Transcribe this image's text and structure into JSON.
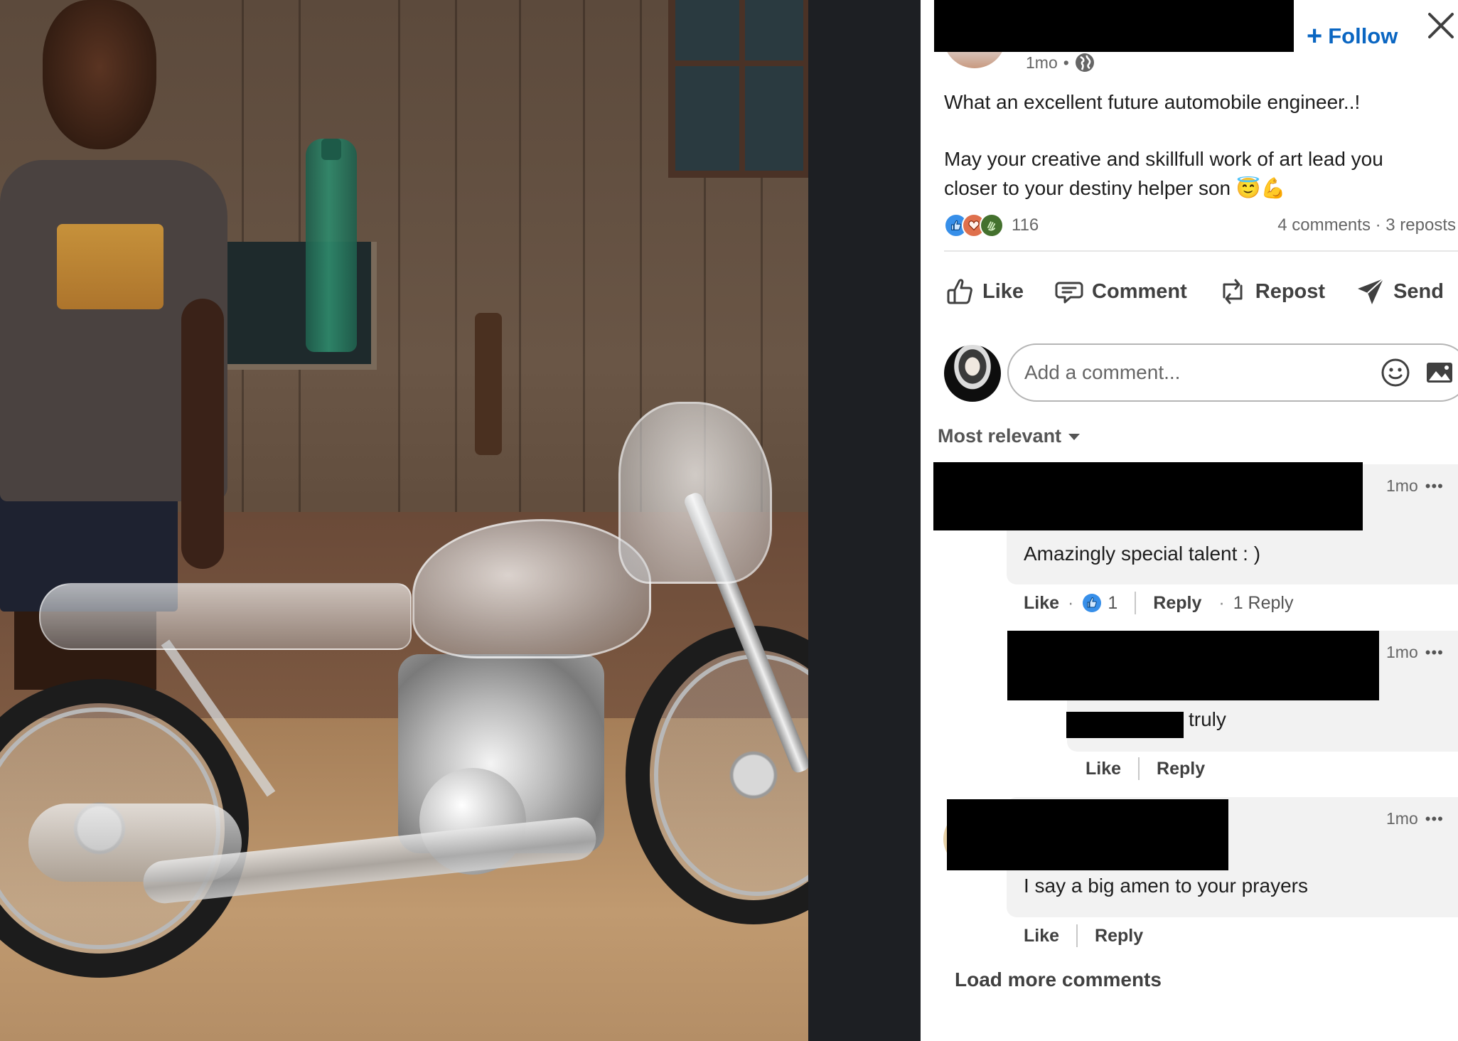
{
  "media": {
    "description": "Photo of a smiling boy standing beside a motorcycle built from transparent plastic bottles"
  },
  "post": {
    "author_name": "[redacted]",
    "follow_label": "Follow",
    "follow_icon": "plus-icon",
    "time": "1mo",
    "visibility_icon": "globe-icon",
    "text_lines": [
      "What an excellent future automobile engineer..!",
      "May your creative and skillfull work of art lead you",
      "closer to your destiny helper son 😇💪"
    ],
    "reactions": {
      "icons": [
        "like-icon",
        "love-icon",
        "celebrate-icon"
      ],
      "count": "116"
    },
    "comments_count": "4 comments",
    "reposts_count": "3 reposts",
    "comments_reposts": "4 comments · 3 reposts"
  },
  "actions": [
    {
      "label": "Like",
      "icon": "thumbs-up-icon"
    },
    {
      "label": "Comment",
      "icon": "comment-icon"
    },
    {
      "label": "Repost",
      "icon": "repost-icon"
    },
    {
      "label": "Send",
      "icon": "send-icon"
    }
  ],
  "comment_box": {
    "placeholder": "Add a comment...",
    "value": "",
    "emoji_icon": "emoji-icon",
    "image_icon": "image-icon"
  },
  "sort": {
    "selected": "Most relevant"
  },
  "comments": [
    {
      "author": "[redacted]",
      "time": "1mo",
      "text": "Amazingly special talent : )",
      "like_label": "Like",
      "like_count": "1",
      "reply_label": "Reply",
      "replies_count": "1 Reply",
      "replies": [
        {
          "author": "[redacted]",
          "mention": "[redacted]",
          "time": "1mo",
          "text": "truly",
          "like_label": "Like",
          "reply_label": "Reply"
        }
      ]
    },
    {
      "author": "[redacted]",
      "time": "1mo",
      "text": "I say a big amen to your prayers",
      "like_label": "Like",
      "reply_label": "Reply"
    }
  ],
  "load_more_label": "Load more comments",
  "colors": {
    "brand_blue": "#0a66c2",
    "like_blue": "#378fe9",
    "love_orange": "#df704d",
    "celebrate_green": "#44712e",
    "bubble_bg": "#f2f2f2",
    "backdrop": "#1d1f23"
  }
}
